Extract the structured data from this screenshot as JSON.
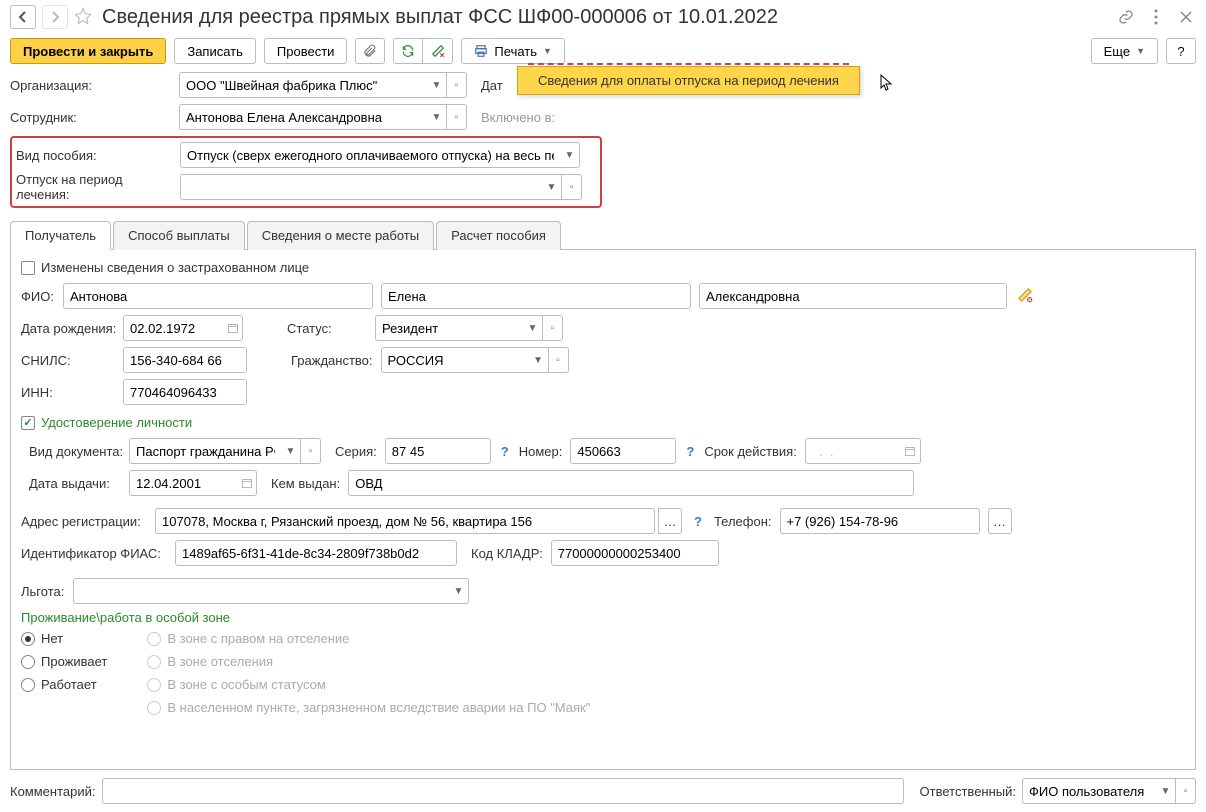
{
  "title": "Сведения для реестра прямых выплат ФСС ШФ00-000006 от 10.01.2022",
  "toolbar": {
    "post_close": "Провести и закрыть",
    "write": "Записать",
    "post": "Провести",
    "print": "Печать",
    "more": "Еще"
  },
  "tooltip": "Сведения для оплаты отпуска на период лечения",
  "header": {
    "org_label": "Организация:",
    "org_value": "ООО \"Швейная фабрика Плюс\"",
    "date_label": "Дат",
    "employee_label": "Сотрудник:",
    "employee_value": "Антонова Елена Александровна",
    "included_label": "Включено в:",
    "benefit_type_label": "Вид пособия:",
    "benefit_type_value": "Отпуск (сверх ежегодного оплачиваемого отпуска) на весь пер",
    "leave_label": "Отпуск на период лечения:",
    "leave_value": ""
  },
  "tabs": {
    "recipient": "Получатель",
    "pay_method": "Способ выплаты",
    "workplace": "Сведения о месте работы",
    "calc": "Расчет пособия"
  },
  "recipient": {
    "changed_label": "Изменены сведения о застрахованном лице",
    "fio_label": "ФИО:",
    "last": "Антонова",
    "first": "Елена",
    "middle": "Александровна",
    "dob_label": "Дата рождения:",
    "dob": "02.02.1972",
    "status_label": "Статус:",
    "status": "Резидент",
    "snils_label": "СНИЛС:",
    "snils": "156-340-684 66",
    "citizenship_label": "Гражданство:",
    "citizenship": "РОССИЯ",
    "inn_label": "ИНН:",
    "inn": "770464096433",
    "identity_title": "Удостоверение личности",
    "doc_type_label": "Вид документа:",
    "doc_type": "Паспорт гражданина РФ",
    "series_label": "Серия:",
    "series": "87 45",
    "number_label": "Номер:",
    "number": "450663",
    "valid_label": "Срок действия:",
    "valid": "  .  .    ",
    "issue_date_label": "Дата выдачи:",
    "issue_date": "12.04.2001",
    "issued_by_label": "Кем выдан:",
    "issued_by": "ОВД",
    "reg_addr_label": "Адрес регистрации:",
    "reg_addr": "107078, Москва г, Рязанский проезд, дом № 56, квартира 156",
    "phone_label": "Телефон:",
    "phone": "+7 (926) 154-78-96",
    "fias_label": "Идентификатор ФИАС:",
    "fias": "1489af65-6f31-41de-8c34-2809f738b0d2",
    "kladr_label": "Код КЛАДР:",
    "kladr": "77000000000253400",
    "privilege_label": "Льгота:",
    "zone_title": "Проживание\\работа в особой зоне",
    "zone_no": "Нет",
    "zone_lives": "Проживает",
    "zone_works": "Работает",
    "zone_right": "В зоне с правом на отселение",
    "zone_reset": "В зоне отселения",
    "zone_special": "В зоне с особым статусом",
    "zone_mayak": "В населенном пункте, загрязненном вследствие аварии на ПО \"Маяк\""
  },
  "footer": {
    "comment_label": "Комментарий:",
    "responsible_label": "Ответственный:",
    "responsible_value": "ФИО пользователя"
  }
}
